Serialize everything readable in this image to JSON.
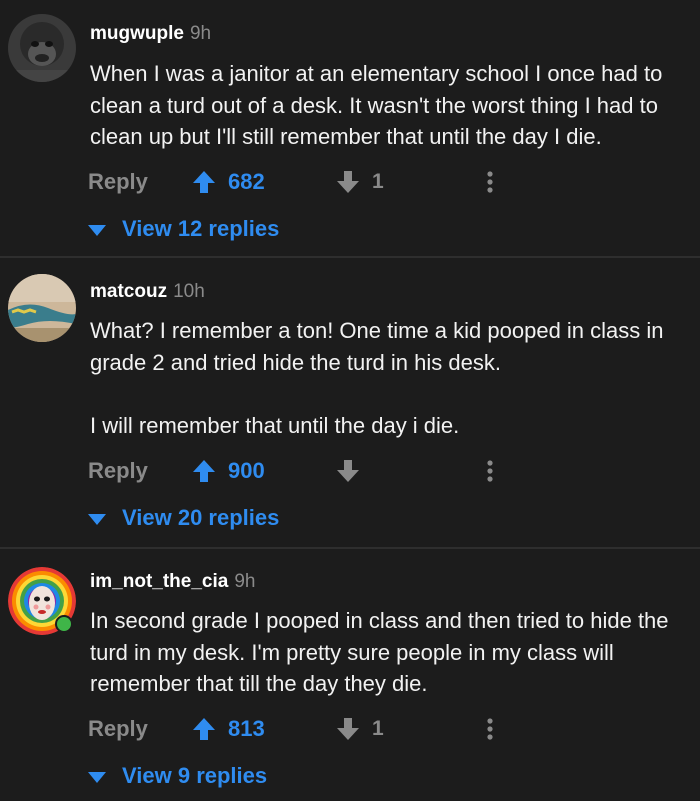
{
  "colors": {
    "background": "#1c1c1c",
    "accent_blue": "#2f8cf0",
    "muted_gray": "#8a8a8a",
    "divider": "#2e2e2e"
  },
  "comments": [
    {
      "username": "mugwuple",
      "time": "9h",
      "body": "When I was a janitor at an elementary school I once had to clean a turd out of a desk. It wasn't the worst thing I had to clean up but I'll still remember that until the day I die.",
      "reply_label": "Reply",
      "upvotes": "682",
      "downvotes": "1",
      "view_replies": "View 12 replies",
      "avatar_icon": "gorilla-avatar-icon"
    },
    {
      "username": "matcouz",
      "time": "10h",
      "body": "What? I remember a ton! One time a kid pooped in class in grade 2 and tried hide the turd in his desk.\n\nI will remember that until the day i die.",
      "reply_label": "Reply",
      "upvotes": "900",
      "downvotes": "",
      "view_replies": "View 20 replies",
      "avatar_icon": "photo-avatar-icon"
    },
    {
      "username": "im_not_the_cia",
      "time": "9h",
      "body": "In second grade I pooped in class and then tried to hide the turd in my desk. I'm pretty sure people in my class will remember that till the day they die.",
      "reply_label": "Reply",
      "upvotes": "813",
      "downvotes": "1",
      "view_replies": "View 9 replies",
      "avatar_icon": "rainbow-face-avatar-icon"
    }
  ]
}
